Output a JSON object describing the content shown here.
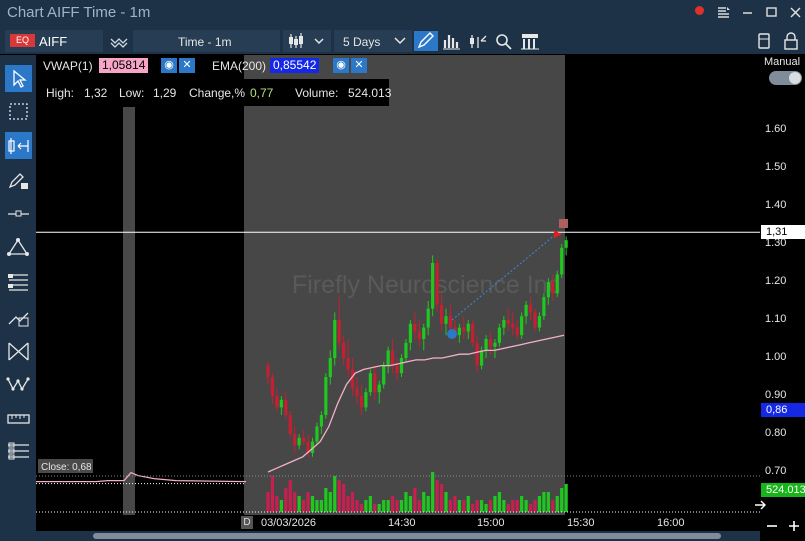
{
  "window": {
    "title": "Chart AIFF Time - 1m",
    "controls": [
      "record-dot",
      "menu-icon",
      "minimize-icon",
      "maximize-icon",
      "close-icon"
    ]
  },
  "toolbar": {
    "badge": "EQ",
    "symbol": "AIFF",
    "timeframe": "Time - 1m",
    "range": "5 Days"
  },
  "indicators": [
    {
      "name": "VWAP(1)",
      "value": "1,05814",
      "color": "#f6a5c8"
    },
    {
      "name": "EMA(200)",
      "value": "0,85542",
      "color": "#1428e6"
    }
  ],
  "ohlc": {
    "high_label": "High:",
    "high": "1,32",
    "low_label": "Low:",
    "low": "1,29",
    "change_label": "Change,%",
    "change": "0,77",
    "volume_label": "Volume:",
    "volume": "524.013"
  },
  "chart_data": {
    "type": "candlestick",
    "watermark": "Firefly Neuroscience Inc",
    "price_axis": {
      "ticks": [
        "1.60",
        "1.50",
        "1.40",
        "1.30",
        "1.20",
        "1.10",
        "1.00",
        "0.90",
        "0.80",
        "0.70"
      ],
      "range": [
        0.64,
        1.66
      ]
    },
    "time_axis": {
      "labels": [
        "03/03/2026",
        "14:30",
        "15:00",
        "15:30",
        "16:00"
      ],
      "day_marker": "D"
    },
    "scale_mode": "Manual",
    "tags": {
      "last": "1,31",
      "ema": "0,86",
      "volume": "524.013"
    },
    "close_label": "Close: 0,68",
    "session_close": 0.68,
    "candles": [
      [
        0.98,
        0.99,
        0.93,
        0.95
      ],
      [
        0.95,
        0.96,
        0.88,
        0.9
      ],
      [
        0.9,
        0.92,
        0.86,
        0.87
      ],
      [
        0.87,
        0.9,
        0.85,
        0.89
      ],
      [
        0.89,
        0.91,
        0.84,
        0.85
      ],
      [
        0.85,
        0.86,
        0.79,
        0.8
      ],
      [
        0.8,
        0.82,
        0.75,
        0.77
      ],
      [
        0.77,
        0.8,
        0.76,
        0.79
      ],
      [
        0.79,
        0.81,
        0.77,
        0.78
      ],
      [
        0.78,
        0.8,
        0.74,
        0.75
      ],
      [
        0.75,
        0.79,
        0.74,
        0.78
      ],
      [
        0.78,
        0.83,
        0.77,
        0.82
      ],
      [
        0.82,
        0.86,
        0.8,
        0.85
      ],
      [
        0.85,
        0.96,
        0.84,
        0.95
      ],
      [
        0.95,
        1.02,
        0.93,
        1.0
      ],
      [
        1.0,
        1.12,
        0.98,
        1.1
      ],
      [
        1.1,
        1.16,
        1.02,
        1.04
      ],
      [
        1.04,
        1.06,
        0.98,
        1.0
      ],
      [
        1.0,
        1.05,
        0.95,
        0.97
      ],
      [
        0.97,
        1.0,
        0.9,
        0.92
      ],
      [
        0.92,
        0.95,
        0.88,
        0.9
      ],
      [
        0.9,
        0.93,
        0.85,
        0.87
      ],
      [
        0.87,
        0.92,
        0.86,
        0.91
      ],
      [
        0.91,
        0.97,
        0.9,
        0.96
      ],
      [
        0.96,
        0.98,
        0.89,
        0.91
      ],
      [
        0.91,
        0.94,
        0.88,
        0.93
      ],
      [
        0.93,
        0.99,
        0.92,
        0.98
      ],
      [
        0.98,
        1.03,
        0.96,
        1.02
      ],
      [
        1.02,
        1.05,
        0.96,
        0.98
      ],
      [
        0.98,
        1.0,
        0.94,
        0.96
      ],
      [
        0.96,
        1.01,
        0.95,
        1.0
      ],
      [
        1.0,
        1.05,
        0.99,
        1.04
      ],
      [
        1.04,
        1.1,
        1.02,
        1.09
      ],
      [
        1.09,
        1.12,
        1.05,
        1.07
      ],
      [
        1.07,
        1.1,
        1.03,
        1.05
      ],
      [
        1.05,
        1.09,
        1.02,
        1.08
      ],
      [
        1.08,
        1.15,
        1.06,
        1.13
      ],
      [
        1.13,
        1.27,
        1.11,
        1.25
      ],
      [
        1.25,
        1.26,
        1.12,
        1.14
      ],
      [
        1.14,
        1.17,
        1.07,
        1.09
      ],
      [
        1.09,
        1.13,
        1.06,
        1.11
      ],
      [
        1.11,
        1.14,
        1.07,
        1.08
      ],
      [
        1.08,
        1.1,
        1.05,
        1.06
      ],
      [
        1.06,
        1.09,
        1.04,
        1.08
      ],
      [
        1.08,
        1.11,
        1.05,
        1.07
      ],
      [
        1.07,
        1.1,
        1.05,
        1.09
      ],
      [
        1.09,
        1.1,
        1.03,
        1.04
      ],
      [
        1.04,
        1.06,
        0.96,
        0.98
      ],
      [
        0.98,
        1.03,
        0.97,
        1.02
      ],
      [
        1.02,
        1.06,
        1.0,
        1.05
      ],
      [
        1.05,
        1.07,
        1.01,
        1.03
      ],
      [
        1.03,
        1.05,
        1.0,
        1.04
      ],
      [
        1.04,
        1.09,
        1.03,
        1.08
      ],
      [
        1.08,
        1.11,
        1.06,
        1.1
      ],
      [
        1.1,
        1.13,
        1.07,
        1.09
      ],
      [
        1.09,
        1.12,
        1.06,
        1.08
      ],
      [
        1.08,
        1.1,
        1.05,
        1.06
      ],
      [
        1.06,
        1.12,
        1.05,
        1.11
      ],
      [
        1.11,
        1.15,
        1.09,
        1.14
      ],
      [
        1.14,
        1.16,
        1.1,
        1.12
      ],
      [
        1.12,
        1.13,
        1.07,
        1.08
      ],
      [
        1.08,
        1.12,
        1.07,
        1.11
      ],
      [
        1.11,
        1.17,
        1.1,
        1.16
      ],
      [
        1.16,
        1.21,
        1.14,
        1.2
      ],
      [
        1.2,
        1.22,
        1.15,
        1.17
      ],
      [
        1.17,
        1.23,
        1.16,
        1.22
      ],
      [
        1.22,
        1.3,
        1.21,
        1.29
      ],
      [
        1.29,
        1.32,
        1.27,
        1.31
      ]
    ],
    "volumes": [
      0.5,
      0.9,
      0.4,
      0.3,
      0.6,
      0.8,
      0.5,
      0.4,
      0.3,
      0.5,
      0.4,
      0.3,
      0.3,
      0.6,
      0.5,
      0.9,
      0.8,
      0.7,
      0.4,
      0.5,
      0.3,
      0.2,
      0.3,
      0.4,
      0.2,
      0.2,
      0.3,
      0.3,
      0.4,
      0.3,
      0.3,
      0.5,
      0.4,
      0.6,
      0.3,
      0.5,
      0.4,
      1.0,
      0.8,
      0.7,
      0.5,
      0.3,
      0.4,
      0.3,
      0.3,
      0.4,
      0.2,
      0.3,
      0.3,
      0.2,
      0.3,
      0.4,
      0.5,
      0.3,
      0.2,
      0.3,
      0.3,
      0.4,
      0.3,
      0.2,
      0.3,
      0.4,
      0.5,
      0.5,
      0.3,
      0.4,
      0.6,
      0.7
    ],
    "vwap": [
      0.7,
      0.71,
      0.72,
      0.73,
      0.74,
      0.76,
      0.78,
      0.82,
      0.88,
      0.93,
      0.96,
      0.97,
      0.975,
      0.98,
      0.98,
      0.985,
      0.99,
      0.995,
      0.995,
      1.0,
      1.0,
      1.005,
      1.01,
      1.01,
      1.015,
      1.02,
      1.02,
      1.025,
      1.03,
      1.035,
      1.04,
      1.045,
      1.05,
      1.055,
      1.06
    ]
  }
}
